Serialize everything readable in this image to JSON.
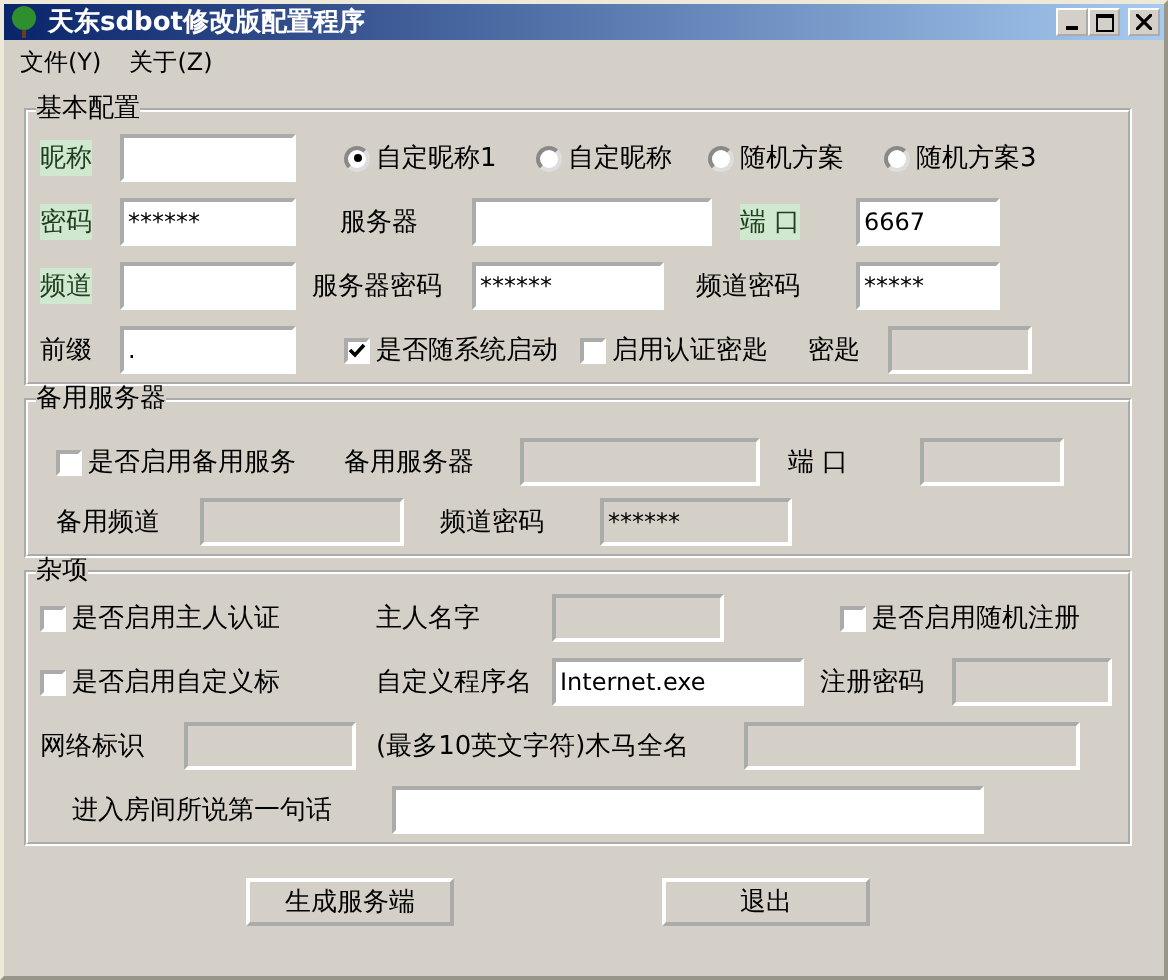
{
  "window": {
    "title": "天东sdbot修改版配置程序"
  },
  "menu": [
    "文件(Y)",
    "关于(Z)"
  ],
  "groups": [
    {
      "title": "基本配置",
      "rows": [
        [
          {
            "kind": "label",
            "text": "昵称",
            "highlighted": true
          },
          {
            "kind": "field",
            "disabled": false
          },
          {
            "kind": "radio",
            "label": "自定昵称1",
            "selected": true
          },
          {
            "kind": "radio",
            "label": "自定昵称",
            "selected": false
          },
          {
            "kind": "radio",
            "label": "随机方案",
            "selected": false
          },
          {
            "kind": "radio",
            "label": "随机方案3",
            "selected": false
          }
        ],
        [
          {
            "kind": "label",
            "text": "密码",
            "highlighted": true
          },
          {
            "kind": "field",
            "value": "******",
            "disabled": false
          },
          {
            "kind": "label",
            "text": "服务器",
            "highlighted": false
          },
          {
            "kind": "field",
            "disabled": false
          },
          {
            "kind": "label",
            "text": "端 口",
            "highlighted": true
          },
          {
            "kind": "field",
            "value": "6667",
            "disabled": false
          }
        ],
        [
          {
            "kind": "label",
            "text": "频道",
            "highlighted": true
          },
          {
            "kind": "field",
            "disabled": false
          },
          {
            "kind": "label",
            "text": "服务器密码",
            "highlighted": false
          },
          {
            "kind": "field",
            "value": "******",
            "disabled": false
          },
          {
            "kind": "label",
            "text": "频道密码",
            "highlighted": false
          },
          {
            "kind": "field",
            "value": "*****",
            "disabled": false
          }
        ],
        [
          {
            "kind": "label",
            "text": "前缀",
            "highlighted": false
          },
          {
            "kind": "field",
            "value": ".",
            "disabled": false
          },
          {
            "kind": "checkbox",
            "label": "是否随系统启动",
            "checked": true
          },
          {
            "kind": "checkbox",
            "label": "启用认证密匙",
            "checked": false
          },
          {
            "kind": "label",
            "text": "密匙",
            "highlighted": false
          },
          {
            "kind": "field",
            "disabled": true
          }
        ]
      ]
    },
    {
      "title": "备用服务器",
      "rows": [
        [
          {
            "kind": "checkbox",
            "label": "是否启用备用服务",
            "checked": false
          },
          {
            "kind": "label",
            "text": "备用服务器",
            "highlighted": false
          },
          {
            "kind": "field",
            "disabled": true
          },
          {
            "kind": "label",
            "text": "端 口",
            "highlighted": false
          },
          {
            "kind": "field",
            "disabled": true
          }
        ],
        [
          {
            "kind": "label",
            "text": "备用频道",
            "highlighted": false
          },
          {
            "kind": "field",
            "disabled": true
          },
          {
            "kind": "label",
            "text": "频道密码",
            "highlighted": false
          },
          {
            "kind": "field",
            "value": "******",
            "disabled": true
          }
        ]
      ]
    },
    {
      "title": "杂项",
      "rows": [
        [
          {
            "kind": "checkbox",
            "label": "是否启用主人认证",
            "checked": false
          },
          {
            "kind": "label",
            "text": "主人名字",
            "highlighted": false
          },
          {
            "kind": "field",
            "disabled": true
          },
          {
            "kind": "checkbox",
            "label": "是否启用随机注册",
            "checked": false
          }
        ],
        [
          {
            "kind": "checkbox",
            "label": "是否启用自定义标",
            "checked": false
          },
          {
            "kind": "label",
            "text": "自定义程序名",
            "highlighted": false
          },
          {
            "kind": "field",
            "value": "Internet.exe",
            "disabled": false
          },
          {
            "kind": "label",
            "text": "注册密码",
            "highlighted": false
          },
          {
            "kind": "field",
            "disabled": true
          }
        ],
        [
          {
            "kind": "label",
            "text": "网络标识",
            "highlighted": false
          },
          {
            "kind": "field",
            "disabled": true
          },
          {
            "kind": "label",
            "text": "(最多10英文字符)木马全名",
            "highlighted": false
          },
          {
            "kind": "field",
            "disabled": true
          }
        ],
        [
          {
            "kind": "label",
            "text": "进入房间所说第一句话",
            "highlighted": false
          },
          {
            "kind": "field",
            "disabled": false
          }
        ]
      ]
    }
  ],
  "buttons": [
    "生成服务端",
    "退出"
  ]
}
